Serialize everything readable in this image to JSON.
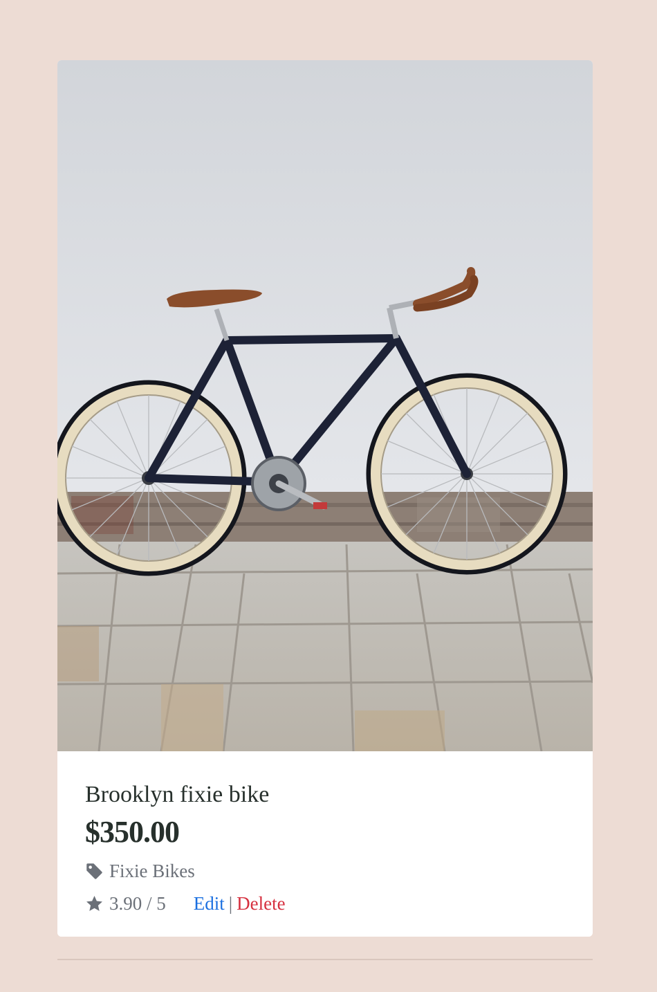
{
  "product": {
    "image_alt": "Dark navy fixed-gear bicycle with cream tires and brown saddle leaning against a white wall",
    "title": "Brooklyn fixie bike",
    "price": "$350.00",
    "category": "Fixie Bikes",
    "category_icon": "tag-icon",
    "rating": "3.90 / 5",
    "rating_icon": "star-icon",
    "edit_label": "Edit",
    "separator": "|",
    "delete_label": "Delete"
  },
  "colors": {
    "page_background": "#eddcd4",
    "text_dark": "#27302c",
    "text_muted": "#6b7078",
    "edit_link": "#1a6fe0",
    "delete_link": "#d6303f"
  }
}
